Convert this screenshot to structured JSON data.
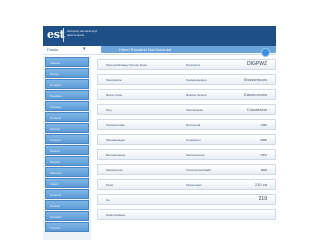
{
  "header": {
    "logo": "est",
    "brand_line1": "eldmpaty denteral diyd",
    "brand_line2": "dpat lemplue"
  },
  "toolbar": {
    "section_label": "Faruls",
    "chevron": "▾"
  },
  "breadcrumb": "Hdeet    Rmsatrst Dat Bnesulat",
  "sidebar": {
    "items": [
      "Cleeset",
      "Sonse",
      "Crnepsrr",
      "Dasdeue",
      "Carpece",
      "Doneuel",
      "Sefcont",
      "Cnoeret",
      "Sersed",
      "Pandlor",
      "Mareeue",
      "Stater",
      "Cnercue",
      "Dossee",
      "Sonsefcl",
      "Tnerdor"
    ]
  },
  "rows": [
    {
      "k": "Sanmeelbrsaaey Dorese Rosa",
      "v": "Dansrwed",
      "n": "DIGPWZ"
    },
    {
      "k": "Sisansetnle",
      "v": "Kesaioestesteu",
      "n": "Sissssmsoos"
    },
    {
      "k": "Rsesc Cese",
      "v": "Rsanee Setsne",
      "n": "Eanecocnow"
    },
    {
      "k": "Peiy",
      "v": "Sancisesase",
      "n": "Cracaesine"
    },
    {
      "k": "Snoiessnseae",
      "v": "Recsoneat",
      "n": "cac"
    },
    {
      "k": "Sanseteasgee",
      "v": "Coneseten",
      "n": "aae"
    },
    {
      "k": "Benseamaane",
      "v": "Ssnsessnenie",
      "n": "nec"
    },
    {
      "k": "Saniseceses",
      "v": "Camrcecescoitadlt",
      "n": "ass"
    },
    {
      "k": "Pesw",
      "v": "Zsaneceast",
      "n": "210  ca"
    },
    {
      "k": "Ue",
      "v": "",
      "n": "219"
    },
    {
      "k": "Neiannedasee",
      "v": "",
      "n": ""
    }
  ]
}
